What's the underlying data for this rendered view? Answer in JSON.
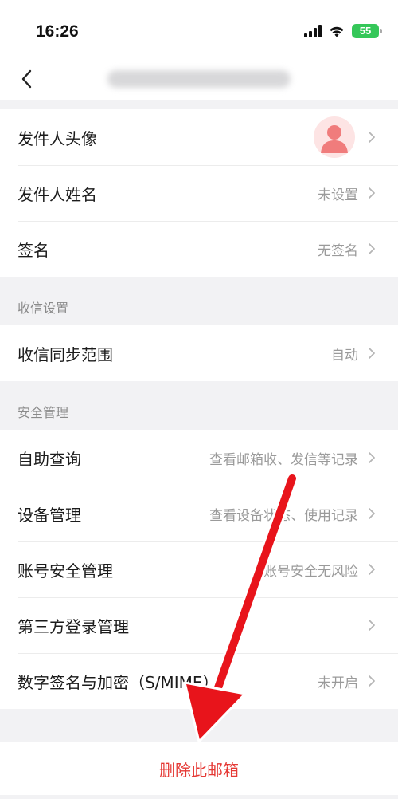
{
  "status_bar": {
    "time": "16:26",
    "battery": "55"
  },
  "nav": {
    "back_icon": "chevron-left-icon"
  },
  "sender_section": {
    "rows": [
      {
        "label": "发件人头像",
        "value": ""
      },
      {
        "label": "发件人姓名",
        "value": "未设置"
      },
      {
        "label": "签名",
        "value": "无签名"
      }
    ]
  },
  "receive_section": {
    "title": "收信设置",
    "rows": [
      {
        "label": "收信同步范围",
        "value": "自动"
      }
    ]
  },
  "security_section": {
    "title": "安全管理",
    "rows": [
      {
        "label": "自助查询",
        "value": "查看邮箱收、发信等记录"
      },
      {
        "label": "设备管理",
        "value": "查看设备状态、使用记录"
      },
      {
        "label": "账号安全管理",
        "value": "账号安全无风险"
      },
      {
        "label": "第三方登录管理",
        "value": ""
      },
      {
        "label": "数字签名与加密（S/MIME）",
        "value": "未开启"
      }
    ]
  },
  "delete_button": {
    "label": "删除此邮箱"
  },
  "colors": {
    "danger": "#e53935",
    "annotation_arrow": "#e8141b",
    "battery": "#35c759"
  }
}
